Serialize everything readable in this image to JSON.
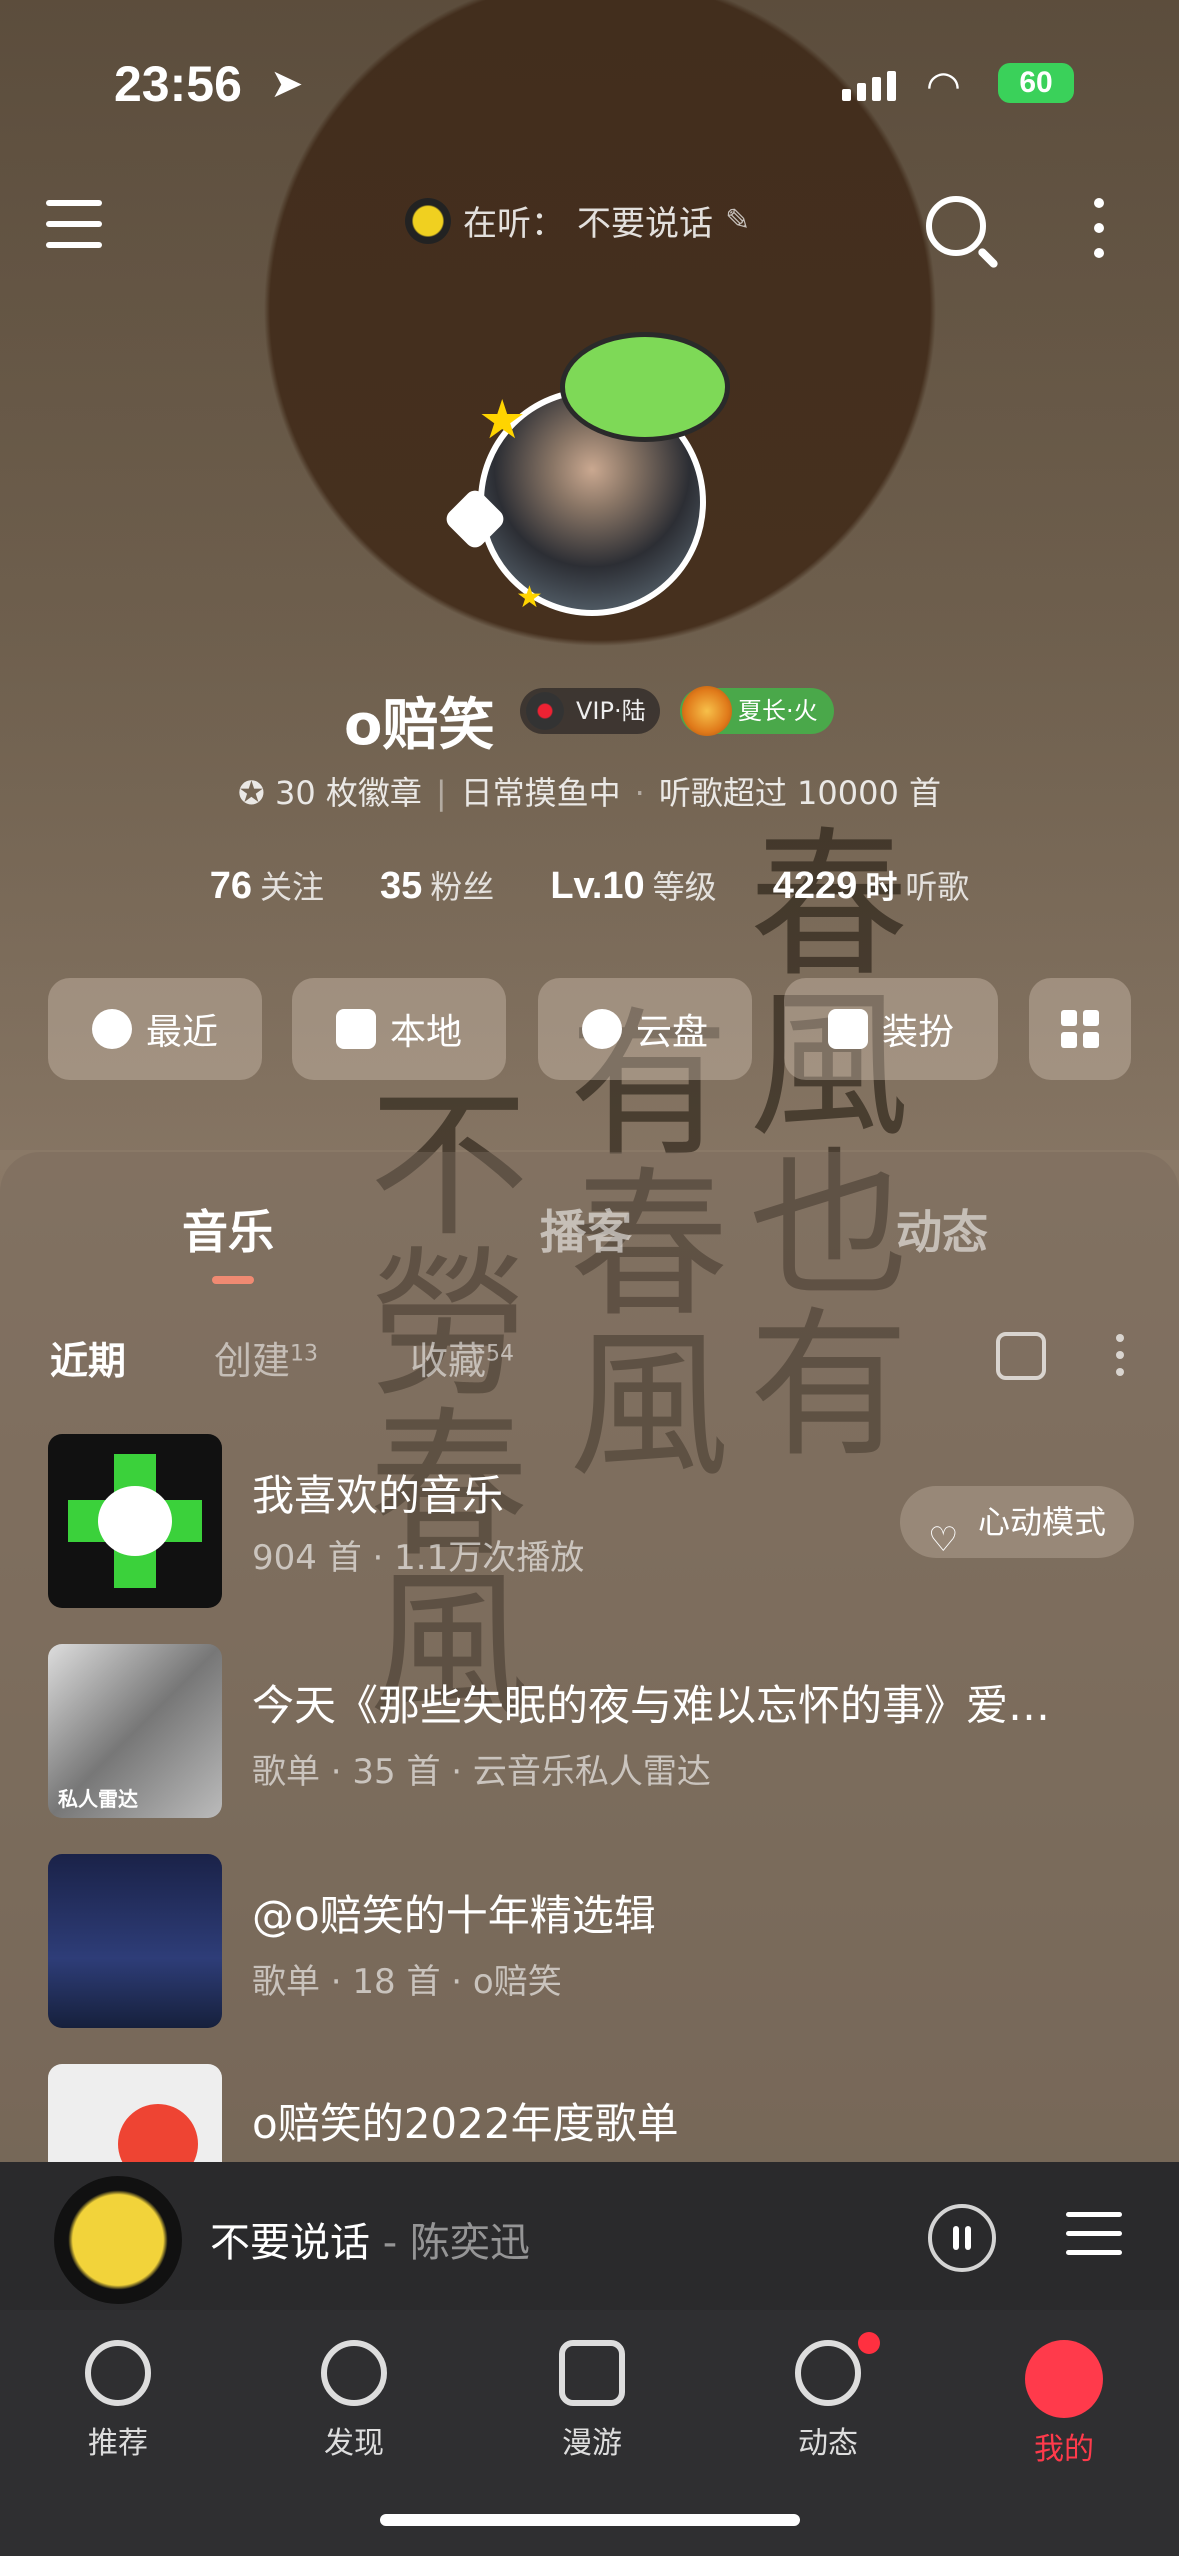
{
  "status": {
    "time": "23:56",
    "battery": "60"
  },
  "header": {
    "now_playing_prefix": "在听：",
    "now_playing_song": "不要说话"
  },
  "profile": {
    "name": "o赔笑",
    "vip_badge": "VIP·陆",
    "level_badge": "夏长·火",
    "badges": "30 枚徽章",
    "status_text": "日常摸鱼中",
    "listen_text": "听歌超过 10000 首",
    "stats": [
      {
        "value": "76",
        "label": "关注"
      },
      {
        "value": "35",
        "label": "粉丝"
      },
      {
        "value": "Lv.10",
        "label": "等级"
      },
      {
        "value": "4229",
        "unit": "时",
        "label": "听歌"
      }
    ]
  },
  "quick_actions": [
    {
      "label": "最近",
      "icon": "clock-icon"
    },
    {
      "label": "本地",
      "icon": "download-box-icon"
    },
    {
      "label": "云盘",
      "icon": "cloud-upload-icon"
    },
    {
      "label": "装扮",
      "icon": "shirt-icon"
    },
    {
      "label": "",
      "icon": "apps-grid-icon"
    }
  ],
  "tabs": [
    "音乐",
    "播客",
    "动态"
  ],
  "subtabs": [
    {
      "label": "近期",
      "count": ""
    },
    {
      "label": "创建",
      "count": "13"
    },
    {
      "label": "收藏",
      "count": "54"
    }
  ],
  "playlists": [
    {
      "title": "我喜欢的音乐",
      "subtitle": "904 首 · 1.1万次播放",
      "action": "心动模式"
    },
    {
      "title": "今天《那些失眠的夜与难以忘怀的事》爱…",
      "subtitle": "歌单 · 35 首 · 云音乐私人雷达",
      "cover_text": "私人雷达"
    },
    {
      "title": "@o赔笑的十年精选辑",
      "subtitle": "歌单 · 18 首 · o赔笑"
    },
    {
      "title": "o赔笑的2022年度歌单",
      "subtitle": ""
    }
  ],
  "player": {
    "song": "不要说话",
    "artist": "- 陈奕迅"
  },
  "nav": [
    {
      "label": "推荐",
      "icon": "recommend-icon"
    },
    {
      "label": "发现",
      "icon": "compass-icon"
    },
    {
      "label": "漫游",
      "icon": "radio-icon"
    },
    {
      "label": "动态",
      "icon": "chat-bubble-icon"
    },
    {
      "label": "我的",
      "icon": "user-vip-icon"
    }
  ],
  "colors": {
    "accent": "#ff3a4b",
    "tab_indicator": "#f08a72",
    "heart_green": "#3bd13b"
  }
}
